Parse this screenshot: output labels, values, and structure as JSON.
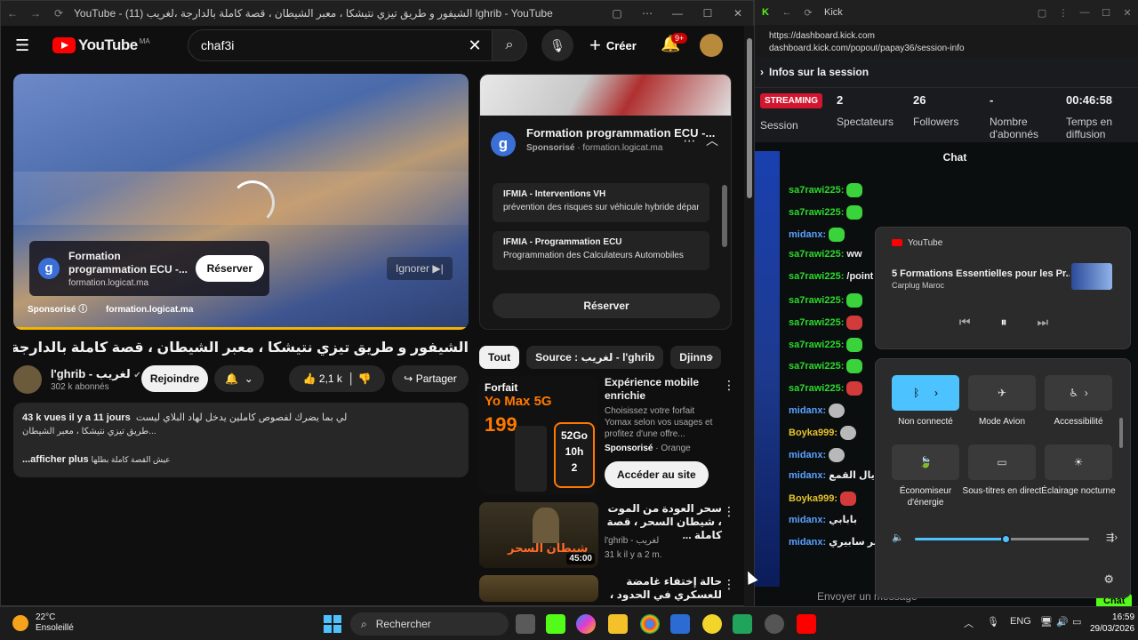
{
  "yt_window": {
    "tab_title": "YouTube - (11) الشيفور و طريق تيزي نتيشكا ، معبر الشيطان ، قصة كاملة بالدارجة ،لغريب lghrib - YouTube",
    "logo_text": "YouTube",
    "logo_country": "MA",
    "search_value": "chaf3i",
    "create_label": "Créer",
    "notif_badge": "9+",
    "player_ad": {
      "title": "Formation programmation ECU -...",
      "domain": "formation.logicat.ma",
      "button": "Réserver",
      "skip": "Ignorer",
      "sponsor_label": "Sponsorisé",
      "sponsor_domain": "formation.logicat.ma",
      "g": "g"
    },
    "video_title": "الشيفور و طريق تيزي نتيشكا ، معبر الشيطان ، قصة كاملة بالدارجة ،لغريب lghrib",
    "channel": {
      "name": "l'ghrib - لغريب",
      "subs": "302 k abonnés",
      "verified": "✔"
    },
    "join_label": "Rejoindre",
    "likes": "2,1 k",
    "share_label": "Partager",
    "description": {
      "meta": "43 k vues  il y a 11 jours",
      "line1": "لي بما يضرك لفصوص كاملين يدخل لهاد البلاي ليست",
      "line2": "طريق تيزي نتيشكا ، معبر الشيطان...",
      "more": "...afficher plus",
      "more_ar": "عيش القصة كاملة بطلها"
    },
    "side_ad": {
      "title": "Formation programmation ECU -...",
      "sponsor": "Sponsorisé",
      "domain": "formation.logicat.ma",
      "g": "g",
      "items": [
        {
          "title": "IFMIA - Interventions VH",
          "sub": "prévention des risques sur véhicule hybride dépan..."
        },
        {
          "title": "IFMIA - Programmation ECU",
          "sub": "Programmation des Calculateurs Automobiles"
        }
      ],
      "button": "Réserver"
    },
    "chips": [
      "Tout",
      "Source : لغريب - l'ghrib",
      "Djinns"
    ],
    "recs": [
      {
        "thumb_lines": [
          "Forfait",
          "Yo Max 5G",
          "199",
          "52Go",
          "10h",
          "2"
        ],
        "title": "Expérience mobile enrichie",
        "sub": "Choisissez votre forfait Yomax selon vos usages et profitez d'une offre...",
        "sponsor": "Sponsorisé",
        "brand": "Orange",
        "button": "Accéder au site"
      },
      {
        "title": "سحر العودة من الموت ، شيطان السحر ، قصة كاملة ...",
        "channel": "l'ghrib - لغريب",
        "stats": "31 k  il y a 2 m.",
        "duration": "45:00",
        "thumb_text": "شيطان السحر"
      },
      {
        "title": "حالة إختفاء غامضة للعسكري في الحدود ، قصة كاملة بالدارجة"
      }
    ]
  },
  "kick_window": {
    "title": "Kick",
    "url1": "https://dashboard.kick.com",
    "url2": "dashboard.kick.com/popout/papay36/session-info",
    "section": "Infos sur la session",
    "stats": [
      {
        "value": "STREAMING",
        "label": "Session"
      },
      {
        "value": "2",
        "label": "Spectateurs"
      },
      {
        "value": "26",
        "label": "Followers"
      },
      {
        "value": "-",
        "label": "Nombre d'abonnés"
      },
      {
        "value": "00:46:58",
        "label": "Temps en diffusion"
      }
    ],
    "chat_title": "Chat",
    "chat": [
      {
        "user": "sa7rawi225:",
        "color": "#2bd92b",
        "text": "",
        "emote": "g"
      },
      {
        "user": "sa7rawi225:",
        "color": "#2bd92b",
        "text": "",
        "emote": "g"
      },
      {
        "user": "midanx:",
        "color": "#5aa0ff",
        "text": "",
        "emote": "g"
      },
      {
        "user": "sa7rawi225:",
        "color": "#2bd92b",
        "text": "ww",
        "emote": ""
      },
      {
        "user": "sa7rawi225:",
        "color": "#2bd92b",
        "text": "/point",
        "emote": ""
      },
      {
        "user": "sa7rawi225:",
        "color": "#2bd92b",
        "text": "",
        "emote": "g"
      },
      {
        "user": "sa7rawi225:",
        "color": "#2bd92b",
        "text": "",
        "emote": "r"
      },
      {
        "user": "sa7rawi225:",
        "color": "#2bd92b",
        "text": "",
        "emote": "g"
      },
      {
        "user": "sa7rawi225:",
        "color": "#2bd92b",
        "text": "",
        "emote": "g"
      },
      {
        "user": "sa7rawi225:",
        "color": "#2bd92b",
        "text": "",
        "emote": "r"
      },
      {
        "user": "midanx:",
        "color": "#5aa0ff",
        "text": "",
        "emote": "s"
      },
      {
        "user": "Boyka999:",
        "color": "#e6c229",
        "text": "",
        "emote": "s"
      },
      {
        "user": "midanx:",
        "color": "#5aa0ff",
        "text": "",
        "emote": "s"
      },
      {
        "user": "midanx:",
        "color": "#5aa0ff",
        "text": "بلاد ديال القمع",
        "emote": ""
      },
      {
        "user": "Boyka999:",
        "color": "#e6c229",
        "text": "",
        "emote": "r"
      },
      {
        "user": "midanx:",
        "color": "#5aa0ff",
        "text": "بابابي",
        "emote": ""
      },
      {
        "user": "midanx:",
        "color": "#5aa0ff",
        "text": "حمر سابيري",
        "emote": ""
      }
    ],
    "input_placeholder": "Envoyer un message",
    "chat_button": "Chat"
  },
  "media_flyout": {
    "source": "YouTube",
    "title": "5 Formations Essentielles pour les Pr...",
    "artist": "Carplug Maroc"
  },
  "quick_settings": {
    "tiles": [
      {
        "label": "Non connecté",
        "on": true
      },
      {
        "label": "Mode Avion",
        "on": false
      },
      {
        "label": "Accessibilité",
        "on": false
      },
      {
        "label": "Économiseur d'énergie",
        "on": false
      },
      {
        "label": "Sous-titres en direct",
        "on": false
      },
      {
        "label": "Éclairage nocturne",
        "on": false
      }
    ],
    "volume": 0.52
  },
  "taskbar": {
    "temp": "22°C",
    "weather": "Ensoleillé",
    "search": "Rechercher",
    "lang": "ENG",
    "time": "16:59",
    "date": "29/03/2026"
  },
  "colors": {
    "yt_red": "#ff0000",
    "kick_green": "#53fc18",
    "accent": "#4cc2ff",
    "streaming": "#d3162f"
  }
}
